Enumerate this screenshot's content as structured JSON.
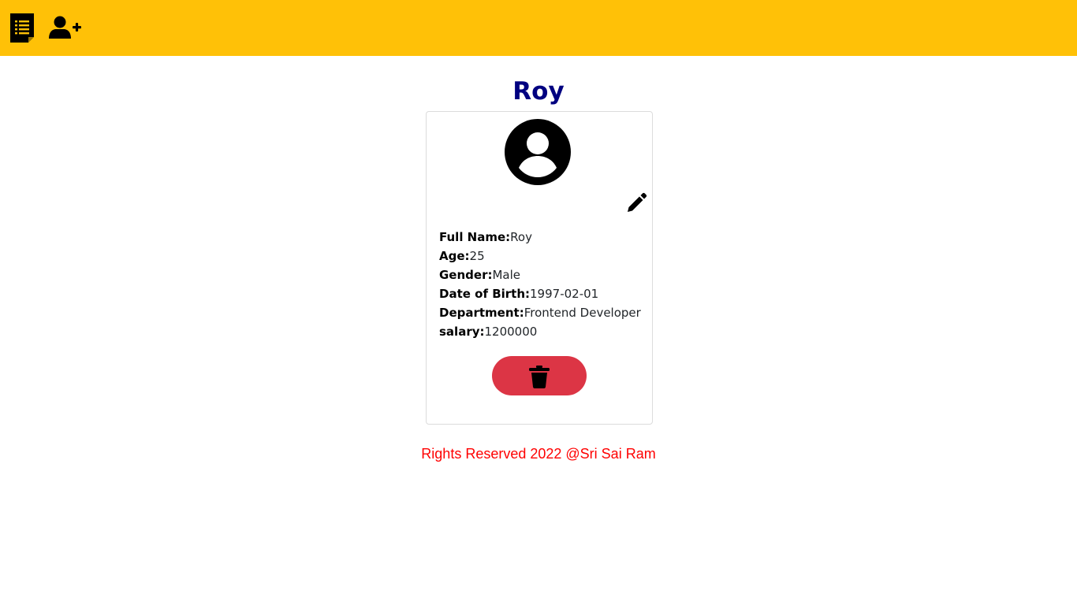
{
  "navbar": {
    "background": "#ffc107",
    "items": [
      {
        "icon": "document-list-icon"
      },
      {
        "icon": "add-user-icon"
      }
    ]
  },
  "profile": {
    "title": "Roy",
    "title_color": "#000080",
    "avatar_icon": "user-circle-icon",
    "edit_icon": "pencil-icon",
    "fields": [
      {
        "label": "Full Name:",
        "value": "Roy"
      },
      {
        "label": "Age:",
        "value": "25"
      },
      {
        "label": "Gender:",
        "value": "Male"
      },
      {
        "label": "Date of Birth:",
        "value": "1997-02-01"
      },
      {
        "label": "Department:",
        "value": "Frontend Developer"
      },
      {
        "label": "salary:",
        "value": "1200000"
      }
    ],
    "delete_icon": "trash-icon",
    "delete_color": "#dc3545"
  },
  "footer": {
    "text": "Rights Reserved 2022 @Sri Sai Ram",
    "color": "#ff0000"
  }
}
